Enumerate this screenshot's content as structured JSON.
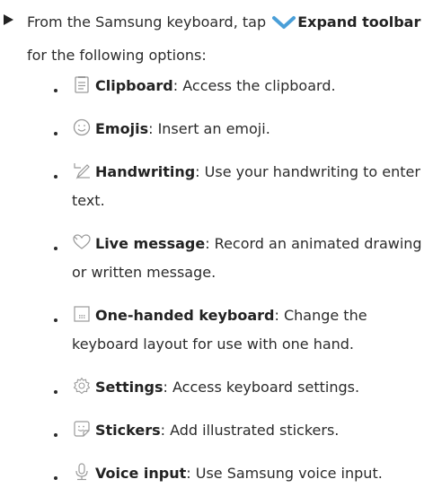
{
  "intro": {
    "before": "From the Samsung keyboard, tap ",
    "action_label": "Expand toolbar",
    "after": " for the following options:",
    "chevron_icon": "chevron-down-icon",
    "chevron_color": "#4a9fd8"
  },
  "options": [
    {
      "icon": "clipboard-icon",
      "name": "Clipboard",
      "desc": ": Access the clipboard."
    },
    {
      "icon": "emoji-icon",
      "name": "Emojis",
      "desc": ": Insert an emoji."
    },
    {
      "icon": "handwriting-icon",
      "name": "Handwriting",
      "desc": ": Use your handwriting to enter text."
    },
    {
      "icon": "live-message-icon",
      "name": "Live message",
      "desc": ": Record an animated drawing or written message."
    },
    {
      "icon": "one-handed-keyboard-icon",
      "name": "One-handed keyboard",
      "desc": ": Change the keyboard layout for use with one hand."
    },
    {
      "icon": "settings-icon",
      "name": "Settings",
      "desc": ": Access keyboard settings."
    },
    {
      "icon": "stickers-icon",
      "name": "Stickers",
      "desc": ": Add illustrated stickers."
    },
    {
      "icon": "voice-input-icon",
      "name": "Voice input",
      "desc": ": Use Samsung voice input."
    }
  ],
  "colors": {
    "icon_stroke": "#9a9a9a",
    "text": "#2b2b2b"
  }
}
